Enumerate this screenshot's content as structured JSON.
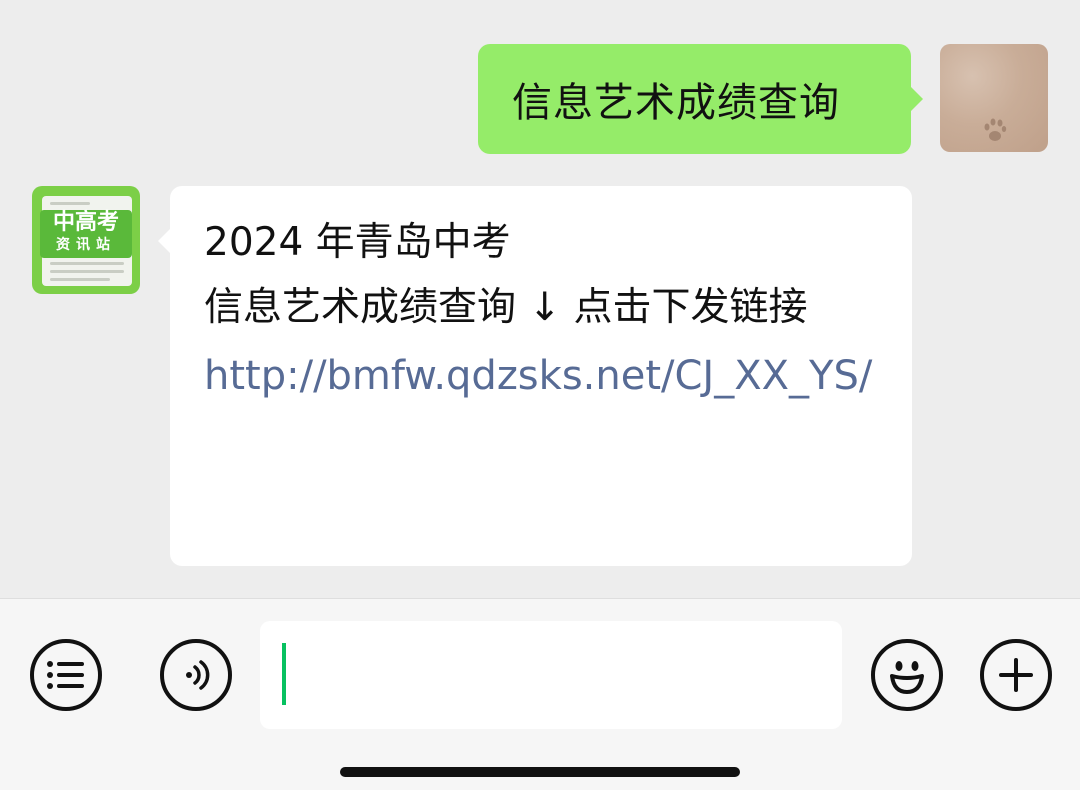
{
  "chat": {
    "outgoing": {
      "text": "信息艺术成绩查询"
    },
    "incoming": {
      "line1": "2024 年青岛中考",
      "line2": "信息艺术成绩查询 ↓ 点击下发链接",
      "link": "http://bmfw.qdzsks.net/CJ_XX_YS/"
    },
    "sender_avatar": {
      "badge_top": "中高考",
      "badge_bottom": "资讯站"
    }
  },
  "input_bar": {
    "input_value": "",
    "icons": [
      "list-menu-icon",
      "voice-icon",
      "emoji-icon",
      "plus-icon"
    ]
  },
  "colors": {
    "outgoing_bubble": "#95ec69",
    "incoming_bubble": "#ffffff",
    "link": "#576b95",
    "caret": "#07c160",
    "background": "#ededed"
  }
}
